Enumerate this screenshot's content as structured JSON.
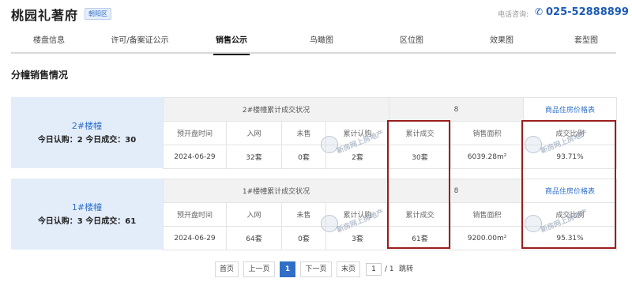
{
  "header": {
    "title": "桃园礼著府",
    "district": "朝阳区",
    "phone_label": "电话咨询:",
    "phone_icon": "phone-icon",
    "phone_number": "025-52888899"
  },
  "tabs": [
    {
      "label": "楼盘信息",
      "active": false
    },
    {
      "label": "许可/备案证公示",
      "active": false
    },
    {
      "label": "销售公示",
      "active": true
    },
    {
      "label": "鸟瞰图",
      "active": false
    },
    {
      "label": "区位图",
      "active": false
    },
    {
      "label": "效果图",
      "active": false
    },
    {
      "label": "套型图",
      "active": false
    }
  ],
  "section_title": "分幢销售情况",
  "buildings": [
    {
      "name": "2#楼幢",
      "today": "今日认购：2 今日成交：30",
      "caption": "2#楼幢累计成交状况",
      "count": "8",
      "link": "商品住房价格表",
      "headers": [
        "预开盘时间",
        "入网",
        "未售",
        "累计认购",
        "累计成交",
        "销售面积",
        "成交比例"
      ],
      "values": [
        "2024-06-29",
        "32套",
        "0套",
        "2套",
        "30套",
        "6039.28m²",
        "93.71%"
      ]
    },
    {
      "name": "1#楼幢",
      "today": "今日认购：3 今日成交：61",
      "caption": "1#楼幢累计成交状况",
      "count": "8",
      "link": "商品住房价格表",
      "headers": [
        "预开盘时间",
        "入网",
        "未售",
        "累计认购",
        "累计成交",
        "销售面积",
        "成交比例"
      ],
      "values": [
        "2024-06-29",
        "64套",
        "0套",
        "3套",
        "61套",
        "9200.00m²",
        "95.31%"
      ]
    }
  ],
  "watermark": "新房网上房地产",
  "pagination": {
    "first": "首页",
    "prev": "上一页",
    "current": "1",
    "next": "下一页",
    "last": "末页",
    "page_input": "1",
    "total": "/ 1",
    "go": "跳转"
  },
  "colors": {
    "accent": "#2f6fc8",
    "highlight_box": "#9b1e1e",
    "building_side_bg": "#e3edfa"
  }
}
